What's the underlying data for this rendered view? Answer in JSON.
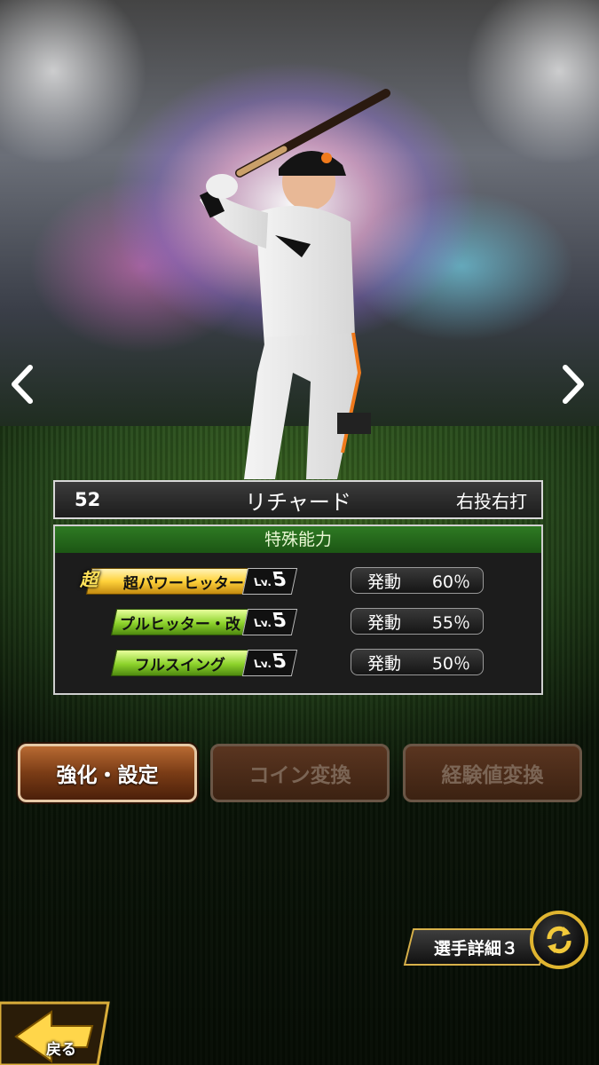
{
  "player": {
    "number": "52",
    "name": "リチャード",
    "handedness": "右投右打"
  },
  "abilities": {
    "header": "特殊能力",
    "lv_prefix": "Lv.",
    "items": [
      {
        "tag": "超",
        "name": "超パワーヒッター",
        "level": "5",
        "activation_label": "発動",
        "activation": "60％",
        "style": "gold"
      },
      {
        "tag": "",
        "name": "プルヒッター・改",
        "level": "5",
        "activation_label": "発動",
        "activation": "55％",
        "style": "green"
      },
      {
        "tag": "",
        "name": "フルスイング",
        "level": "5",
        "activation_label": "発動",
        "activation": "50％",
        "style": "green"
      }
    ]
  },
  "buttons": {
    "enhance": "強化・設定",
    "coin_exchange": "コイン変換",
    "exp_exchange": "経験値変換"
  },
  "detail": {
    "label": "選手詳細３"
  },
  "back": {
    "label": "戻る"
  },
  "icons": {
    "prev": "chevron-left-icon",
    "next": "chevron-right-icon",
    "cycle": "cycle-arrows-icon",
    "back": "back-arrow-icon"
  },
  "colors": {
    "ability_header": "#2e7a23",
    "gold_accent": "#e0b530",
    "button_brown": "#7a3c16"
  }
}
